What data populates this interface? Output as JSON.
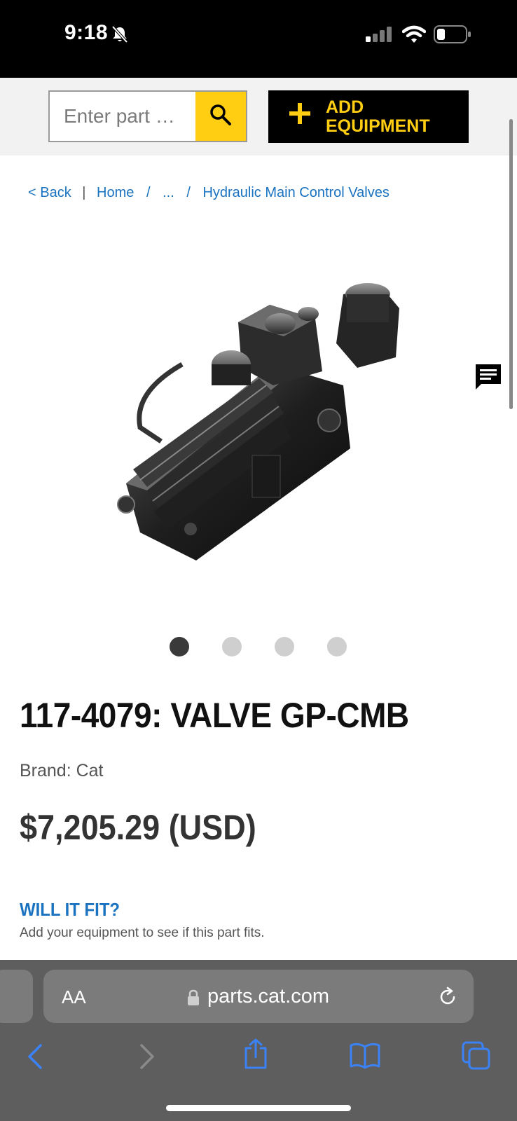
{
  "status_bar": {
    "time": "9:18"
  },
  "header": {
    "search_placeholder": "Enter part …",
    "add_equipment_label": "Add Equipment"
  },
  "breadcrumb": {
    "back": "< Back",
    "separator": "|",
    "home": "Home",
    "slash": "/",
    "ellipsis": "...",
    "current": "Hydraulic Main Control Valves"
  },
  "carousel": {
    "count": 4,
    "active_index": 0
  },
  "product": {
    "title": "117-4079: VALVE GP-CMB",
    "brand": "Brand: Cat",
    "price": "$7,205.29 (USD)"
  },
  "fit": {
    "heading": "WILL IT FIT?",
    "description": "Add your equipment to see if this part fits."
  },
  "browser": {
    "aa": "AA",
    "url": "parts.cat.com"
  },
  "colors": {
    "brand_yellow": "#ffcd11",
    "link_blue": "#1a73c0",
    "browser_chrome": "#5e5e5e",
    "nav_icon_blue": "#3b82f6"
  },
  "icons": [
    "bell-slash-icon",
    "signal-icon",
    "wifi-icon",
    "battery-icon",
    "search-icon",
    "plus-icon",
    "chat-icon",
    "lock-icon",
    "reload-icon",
    "back-arrow-icon",
    "forward-arrow-icon",
    "share-icon",
    "bookmarks-icon",
    "tabs-icon"
  ]
}
